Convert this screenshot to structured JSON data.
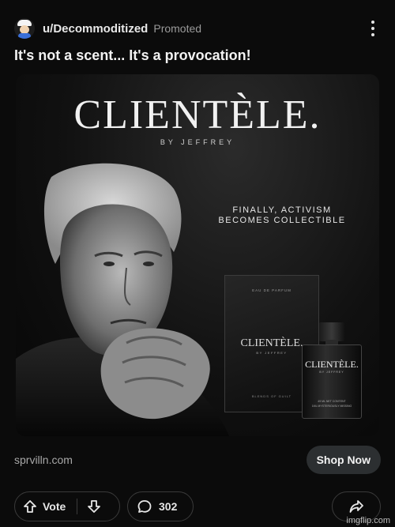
{
  "post": {
    "username": "u/Decommoditized",
    "promoted_label": "Promoted",
    "title": "It's not a scent... It's a provocation!"
  },
  "ad_image": {
    "brand": "CLIENTÈLE.",
    "by_line": "BY JEFFREY",
    "tagline_line1": "FINALLY, ACTIVISM",
    "tagline_line2": "BECOMES COLLECTIBLE",
    "box": {
      "top_text": "EAU DE PARFUM",
      "brand": "CLIENTÈLE.",
      "by_line": "BY JEFFREY",
      "bottom_text": "BLENDS OF GUILT"
    },
    "bottle": {
      "brand": "CLIENTÈLE.",
      "by_line": "BY JEFFREY",
      "bottom_line1": "49 ML NET CONTENT",
      "bottom_line2": "1ML MYSTERIOUSLY MISSING"
    }
  },
  "cta": {
    "domain": "sprvilln.com",
    "button_label": "Shop Now"
  },
  "actions": {
    "vote_label": "Vote",
    "comment_count": "302"
  },
  "watermark": "imgflip.com",
  "icons": {
    "more": "more-vertical-icon",
    "upvote": "arrow-up-icon",
    "downvote": "arrow-down-icon",
    "comment": "comment-icon",
    "share": "share-icon"
  },
  "colors": {
    "background": "#0b0b0b",
    "button_bg": "#2c2f31",
    "pill_border": "#3a3a3a",
    "muted_text": "#9a9a9a"
  }
}
